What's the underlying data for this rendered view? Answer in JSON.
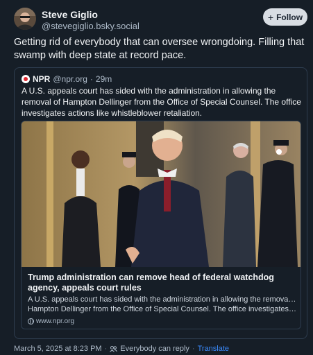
{
  "author": {
    "name": "Steve Giglio",
    "handle": "@stevegiglio.bsky.social"
  },
  "follow": {
    "plus": "+",
    "label": "Follow"
  },
  "post": {
    "text": "Getting rid of everybody that can oversee wrongdoing. Filling that swamp with deep state at record pace."
  },
  "quote": {
    "name": "NPR",
    "handle": "@npr.org",
    "separator": "·",
    "time": "29m",
    "text": "A U.S. appeals court has sided with the administration in allowing the removal of Hampton Dellinger from the Office of Special Counsel. The office investigates actions like whistleblower retaliation.",
    "card": {
      "title": "Trump administration can remove head of federal watchdog agency, appeals court rules",
      "description_line1": "A U.S. appeals court has sided with the administration in allowing the removal of",
      "description_line2": "Hampton Dellinger from the Office of Special Counsel. The office investigates ...",
      "domain": "www.npr.org"
    }
  },
  "footer": {
    "timestamp": "March 5, 2025 at 8:23 PM",
    "sep1": "·",
    "reply_setting": "Everybody can reply",
    "sep2": "·",
    "translate": "Translate"
  },
  "colors": {
    "background": "#161e27",
    "accent": "#3b8cff",
    "border": "#2e3d4f",
    "muted": "#aebbc9"
  },
  "icons": {
    "follow": "plus-icon",
    "source": "npr-logo-icon",
    "domain": "globe-icon",
    "reply": "people-icon"
  }
}
